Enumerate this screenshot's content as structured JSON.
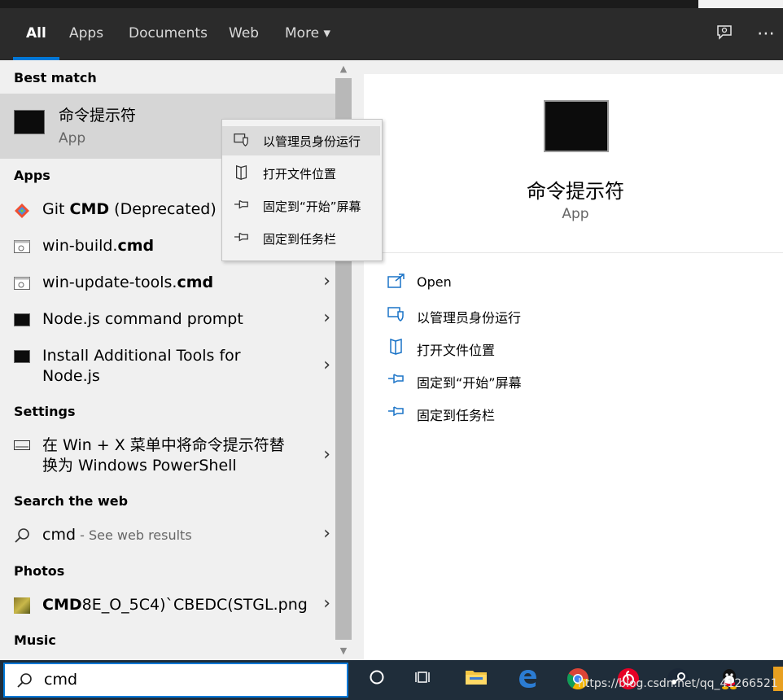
{
  "header": {
    "tabs": [
      {
        "label": "All",
        "active": true
      },
      {
        "label": "Apps"
      },
      {
        "label": "Documents"
      },
      {
        "label": "Web"
      },
      {
        "label": "More ▾"
      }
    ],
    "feedback_icon": "feedback-icon",
    "more_icon": "ellipsis-icon"
  },
  "best_match": {
    "section": "Best match",
    "name": "命令提示符",
    "type": "App"
  },
  "context_menu": [
    {
      "label": "以管理员身份运行",
      "icon": "shield-icon"
    },
    {
      "label": "打开文件位置",
      "icon": "file-location-icon"
    },
    {
      "label": "固定到“开始”屏幕",
      "icon": "pin-icon"
    },
    {
      "label": "固定到任务栏",
      "icon": "pin-icon"
    }
  ],
  "apps": {
    "section": "Apps",
    "items": [
      {
        "pre": "Git ",
        "bold": "CMD",
        "post": " (Deprecated)"
      },
      {
        "pre": "win-build.",
        "bold": "cmd",
        "post": ""
      },
      {
        "pre": "win-update-tools.",
        "bold": "cmd",
        "post": ""
      },
      {
        "pre": "Node.js command prompt",
        "bold": "",
        "post": ""
      },
      {
        "line1": "Install Additional Tools for",
        "line2": "Node.js"
      }
    ]
  },
  "settings": {
    "section": "Settings",
    "line1": "在 Win + X 菜单中将命令提示符替",
    "line2": "换为 Windows PowerShell"
  },
  "web": {
    "section": "Search the web",
    "query": "cmd",
    "suffix": " - See web results"
  },
  "photos": {
    "section": "Photos",
    "bold": "CMD",
    "rest": "8E_O_5C4)`CBEDC(STGL.png"
  },
  "music": {
    "section": "Music"
  },
  "preview": {
    "name": "命令提示符",
    "type": "App",
    "actions": [
      {
        "label": "Open",
        "icon": "open-icon"
      },
      {
        "label": "以管理员身份运行",
        "icon": "shield-icon"
      },
      {
        "label": "打开文件位置",
        "icon": "file-location-icon"
      },
      {
        "label": "固定到“开始”屏幕",
        "icon": "pin-icon"
      },
      {
        "label": "固定到任务栏",
        "icon": "pin-icon"
      }
    ]
  },
  "search": {
    "value": "cmd"
  },
  "watermark": "https://blog.csdn.net/qq_41266521",
  "colors": {
    "accent": "#0078d7",
    "header": "#2b2b2b",
    "taskbar": "#1f2d3a"
  }
}
